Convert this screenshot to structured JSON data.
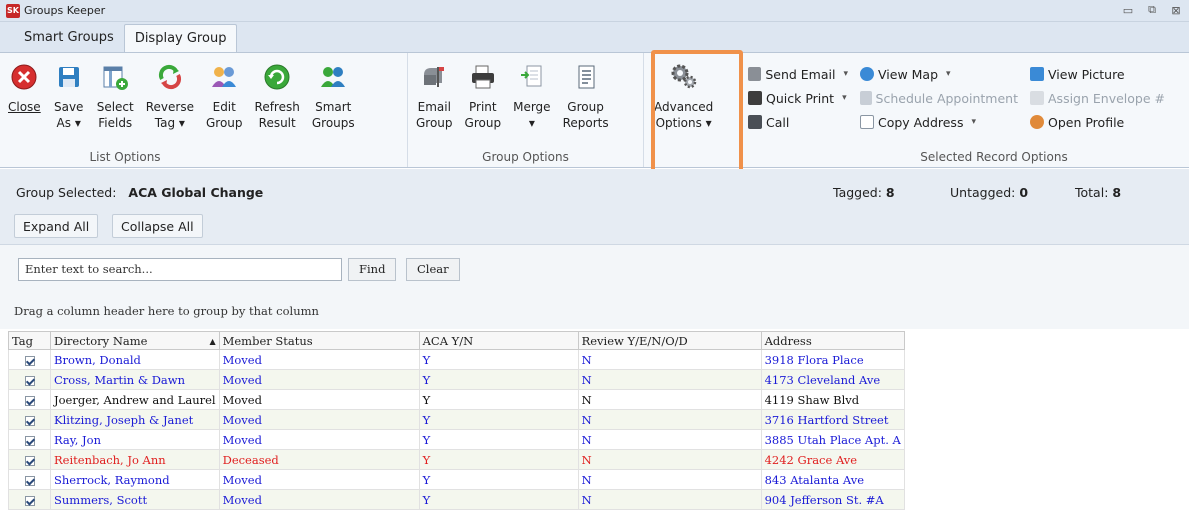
{
  "app": {
    "logo": "SK",
    "title": "Groups Keeper"
  },
  "window_controls": {
    "minimize": "▭",
    "restore": "⧉",
    "close": "⊠"
  },
  "tabs": [
    {
      "label": "Smart Groups",
      "active": false
    },
    {
      "label": "Display Group",
      "active": true
    }
  ],
  "ribbon": {
    "list_options": {
      "label": "List Options",
      "buttons": [
        {
          "line1": "Close",
          "line2": "",
          "icon": "close-circle-icon"
        },
        {
          "line1": "Save",
          "line2": "As ▾",
          "icon": "save-icon"
        },
        {
          "line1": "Select",
          "line2": "Fields",
          "icon": "select-fields-icon"
        },
        {
          "line1": "Reverse",
          "line2": "Tag ▾",
          "icon": "reverse-tag-icon"
        },
        {
          "line1": "Edit",
          "line2": "Group",
          "icon": "edit-group-icon"
        },
        {
          "line1": "Refresh",
          "line2": "Result",
          "icon": "refresh-icon"
        },
        {
          "line1": "Smart",
          "line2": "Groups",
          "icon": "smart-groups-icon"
        }
      ]
    },
    "group_options": {
      "label": "Group Options",
      "buttons": [
        {
          "line1": "Email",
          "line2": "Group",
          "icon": "mailbox-icon"
        },
        {
          "line1": "Print",
          "line2": "Group",
          "icon": "printer-icon"
        },
        {
          "line1": "Merge",
          "line2": "▾",
          "icon": "merge-icon"
        },
        {
          "line1": "Group",
          "line2": "Reports",
          "icon": "report-icon"
        }
      ]
    },
    "advanced": {
      "line1": "Advanced",
      "line2": "Options ▾",
      "icon": "gears-icon"
    },
    "selected_record_options": {
      "label": "Selected Record Options",
      "col1": [
        {
          "label": "Send Email",
          "caret": "▾",
          "icon": "email-icon",
          "disabled": false
        },
        {
          "label": "Quick Print",
          "caret": "▾",
          "icon": "quick-print-icon",
          "disabled": false
        },
        {
          "label": "Call",
          "caret": "",
          "icon": "phone-icon",
          "disabled": false
        }
      ],
      "col2": [
        {
          "label": "View Map",
          "caret": "▾",
          "icon": "globe-icon",
          "disabled": false
        },
        {
          "label": "Schedule Appointment",
          "caret": "",
          "icon": "calendar-icon",
          "disabled": true
        },
        {
          "label": "Copy Address",
          "caret": "▾",
          "icon": "copy-icon",
          "disabled": false
        }
      ],
      "col3": [
        {
          "label": "View Picture",
          "caret": "",
          "icon": "picture-icon",
          "disabled": false
        },
        {
          "label": "Assign Envelope #",
          "caret": "",
          "icon": "envelope-icon",
          "disabled": true
        },
        {
          "label": "Open Profile",
          "caret": "",
          "icon": "profile-icon",
          "disabled": false
        }
      ]
    }
  },
  "group_info": {
    "selected_label": "Group Selected:",
    "selected_value": "ACA Global Change",
    "tagged_label": "Tagged:",
    "tagged_value": "8",
    "untagged_label": "Untagged:",
    "untagged_value": "0",
    "total_label": "Total:",
    "total_value": "8",
    "expand_all": "Expand All",
    "collapse_all": "Collapse All"
  },
  "search": {
    "placeholder": "Enter text to search...",
    "find": "Find",
    "clear": "Clear",
    "drag_hint": "Drag a column header here to group by that column"
  },
  "grid": {
    "columns": [
      "Tag",
      "Directory Name",
      "Member Status",
      "ACA Y/N",
      "Review Y/E/N/O/D",
      "Address"
    ],
    "sort_indicator": "▲",
    "rows": [
      {
        "name": "Brown, Donald",
        "status": "Moved",
        "aca": "Y",
        "review": "N",
        "address": "3918 Flora Place",
        "color": "#1a1ad6"
      },
      {
        "name": "Cross, Martin & Dawn",
        "status": "Moved",
        "aca": "Y",
        "review": "N",
        "address": "4173 Cleveland Ave",
        "color": "#1a1ad6"
      },
      {
        "name": "Joerger, Andrew and Laurel",
        "status": "Moved",
        "aca": "Y",
        "review": "N",
        "address": "4119 Shaw Blvd",
        "color": "#111111"
      },
      {
        "name": "Klitzing, Joseph & Janet",
        "status": "Moved",
        "aca": "Y",
        "review": "N",
        "address": "3716 Hartford Street",
        "color": "#1a1ad6"
      },
      {
        "name": "Ray, Jon",
        "status": "Moved",
        "aca": "Y",
        "review": "N",
        "address": "3885 Utah Place Apt. A",
        "color": "#1a1ad6"
      },
      {
        "name": "Reitenbach, Jo Ann",
        "status": "Deceased",
        "aca": "Y",
        "review": "N",
        "address": "4242 Grace Ave",
        "color": "#e02020"
      },
      {
        "name": "Sherrock, Raymond",
        "status": "Moved",
        "aca": "Y",
        "review": "N",
        "address": "843 Atalanta Ave",
        "color": "#1a1ad6"
      },
      {
        "name": "Summers, Scott",
        "status": "Moved",
        "aca": "Y",
        "review": "N",
        "address": "904 Jefferson St. #A",
        "color": "#1a1ad6"
      }
    ]
  }
}
